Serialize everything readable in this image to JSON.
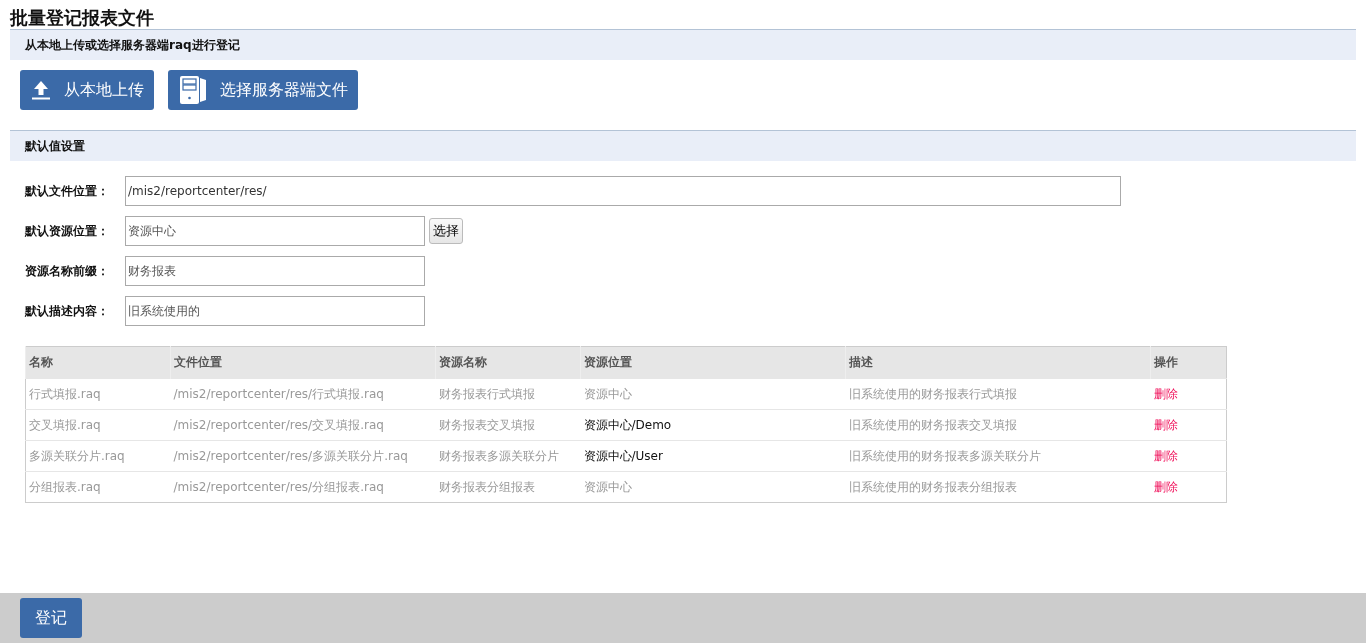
{
  "page": {
    "title": "批量登记报表文件"
  },
  "upload_section": {
    "heading": "从本地上传或选择服务器端raq进行登记",
    "buttons": [
      {
        "kind": "upload",
        "label": "从本地上传"
      },
      {
        "kind": "server",
        "label": "选择服务器端文件"
      }
    ]
  },
  "defaults_section": {
    "heading": "默认值设置",
    "fields": [
      {
        "label": "默认文件位置：",
        "value": "/mis2/reportcenter/res/",
        "wide": true
      },
      {
        "label": "默认资源位置：",
        "value": "资源中心",
        "wide": false,
        "button": "选择"
      },
      {
        "label": "资源名称前缀：",
        "value": "财务报表",
        "wide": false
      },
      {
        "label": "默认描述内容：",
        "value": "旧系统使用的",
        "wide": false
      }
    ]
  },
  "table": {
    "columns": [
      "名称",
      "文件位置",
      "资源名称",
      "资源位置",
      "描述",
      "操作"
    ],
    "rows": [
      {
        "name": "行式填报.raq",
        "file_location": "/mis2/reportcenter/res/行式填报.raq",
        "resource_name": "财务报表行式填报",
        "resource_location": "资源中心",
        "location_highlighted": false,
        "description": "旧系统使用的财务报表行式填报",
        "action": "删除"
      },
      {
        "name": "交叉填报.raq",
        "file_location": "/mis2/reportcenter/res/交叉填报.raq",
        "resource_name": "财务报表交叉填报",
        "resource_location": "资源中心/Demo",
        "location_highlighted": true,
        "description": "旧系统使用的财务报表交叉填报",
        "action": "删除"
      },
      {
        "name": "多源关联分片.raq",
        "file_location": "/mis2/reportcenter/res/多源关联分片.raq",
        "resource_name": "财务报表多源关联分片",
        "resource_location": "资源中心/User",
        "location_highlighted": true,
        "description": "旧系统使用的财务报表多源关联分片",
        "action": "删除"
      },
      {
        "name": "分组报表.raq",
        "file_location": "/mis2/reportcenter/res/分组报表.raq",
        "resource_name": "财务报表分组报表",
        "resource_location": "资源中心",
        "location_highlighted": false,
        "description": "旧系统使用的财务报表分组报表",
        "action": "删除"
      }
    ]
  },
  "footer": {
    "submit_button": "登记"
  }
}
